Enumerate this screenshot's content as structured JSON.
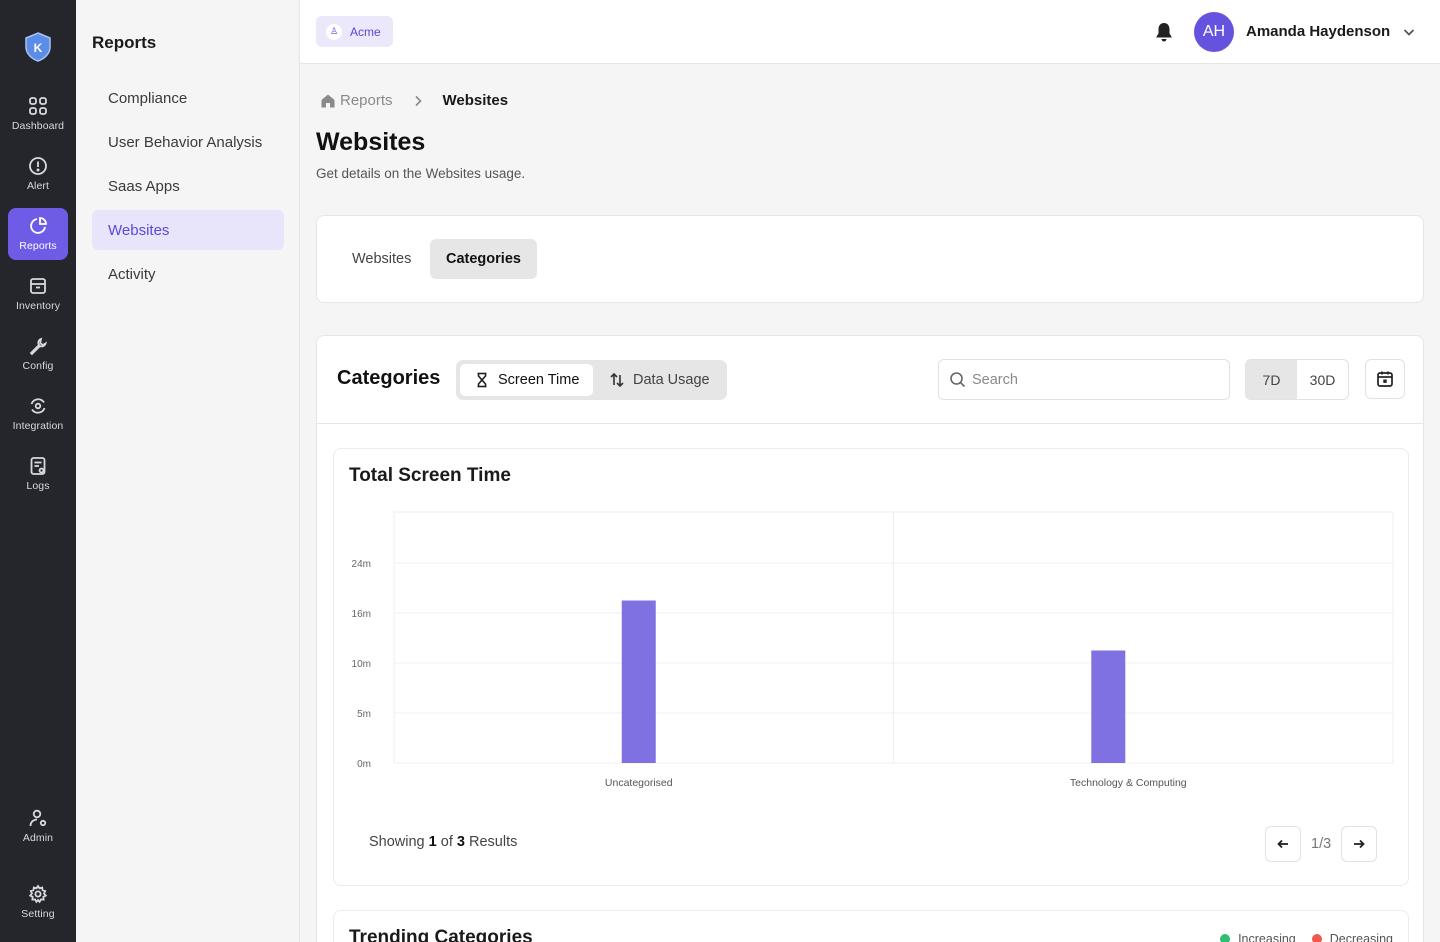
{
  "rail": {
    "items": [
      {
        "label": "Dashboard",
        "icon": "grid-icon"
      },
      {
        "label": "Alert",
        "icon": "alert-circle-icon"
      },
      {
        "label": "Reports",
        "icon": "pie-chart-icon"
      },
      {
        "label": "Inventory",
        "icon": "archive-icon"
      },
      {
        "label": "Config",
        "icon": "wrench-icon"
      },
      {
        "label": "Integration",
        "icon": "sync-icon"
      },
      {
        "label": "Logs",
        "icon": "file-icon"
      },
      {
        "label": "Admin",
        "icon": "user-gear-icon"
      },
      {
        "label": "Setting",
        "icon": "gear-icon"
      }
    ],
    "logo_letter": "K"
  },
  "sidebar": {
    "title": "Reports",
    "items": [
      {
        "label": "Compliance"
      },
      {
        "label": "User Behavior Analysis"
      },
      {
        "label": "Saas Apps"
      },
      {
        "label": "Websites"
      },
      {
        "label": "Activity"
      }
    ]
  },
  "topbar": {
    "org_name": "Acme",
    "avatar_initials": "AH",
    "user_name": "Amanda Haydenson"
  },
  "breadcrumb": {
    "parent": "Reports",
    "current": "Websites"
  },
  "page": {
    "title": "Websites",
    "subtitle": "Get details on the Websites usage."
  },
  "tabs": {
    "websites": "Websites",
    "categories": "Categories"
  },
  "panel": {
    "title": "Categories",
    "seg_screen": "Screen Time",
    "seg_data": "Data Usage",
    "search_placeholder": "Search",
    "range_7d": "7D",
    "range_30d": "30D"
  },
  "chart_data": {
    "type": "bar",
    "title": "Total Screen Time",
    "categories": [
      "Uncategorised",
      "Technology & Computing"
    ],
    "values": [
      19.5,
      13.5
    ],
    "unit": "m",
    "yticks": [
      "24m",
      "16m",
      "10m",
      "5m",
      "0m"
    ],
    "ylim": [
      0,
      24
    ],
    "grid": true,
    "bar_color": "#8071e3"
  },
  "pagination": {
    "showing_prefix": "Showing",
    "showing_count": "1",
    "of_word": "of",
    "total": "3",
    "results_word": "Results",
    "page_info": "1/3"
  },
  "trending": {
    "title": "Trending Categories",
    "legend": [
      {
        "label": "Increasing",
        "color": "#2fbf71"
      },
      {
        "label": "Decreasing",
        "color": "#ef5a4c"
      }
    ]
  }
}
